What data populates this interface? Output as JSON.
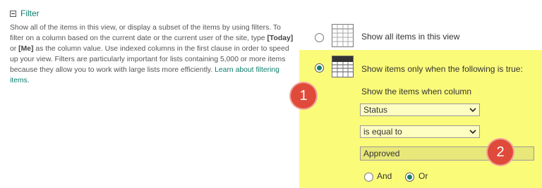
{
  "section": {
    "title": "Filter",
    "description_parts": {
      "p1": "Show all of the items in this view, or display a subset of the items by using filters. To filter on a column based on the current date or the current user of the site, type ",
      "today": "[Today]",
      "or": " or ",
      "me": "[Me]",
      "p2": " as the column value. Use indexed columns in the first clause in order to speed up your view. Filters are particularly important for lists containing 5,000 or more items because they allow you to work with large lists more efficiently. ",
      "link": "Learn about filtering items."
    }
  },
  "options": {
    "show_all_label": "Show all items in this view",
    "show_filtered_label": "Show items only when the following is true:"
  },
  "filter": {
    "column_prompt": "Show the items when column",
    "column_value": "Status",
    "operator_value": "is equal to",
    "value": "Approved",
    "and_label": "And",
    "or_label": "Or"
  },
  "badges": [
    "1",
    "2"
  ],
  "colors": {
    "accent": "#0f7d6e",
    "highlight": "#fbfb7a",
    "badge": "#e04a3a"
  }
}
